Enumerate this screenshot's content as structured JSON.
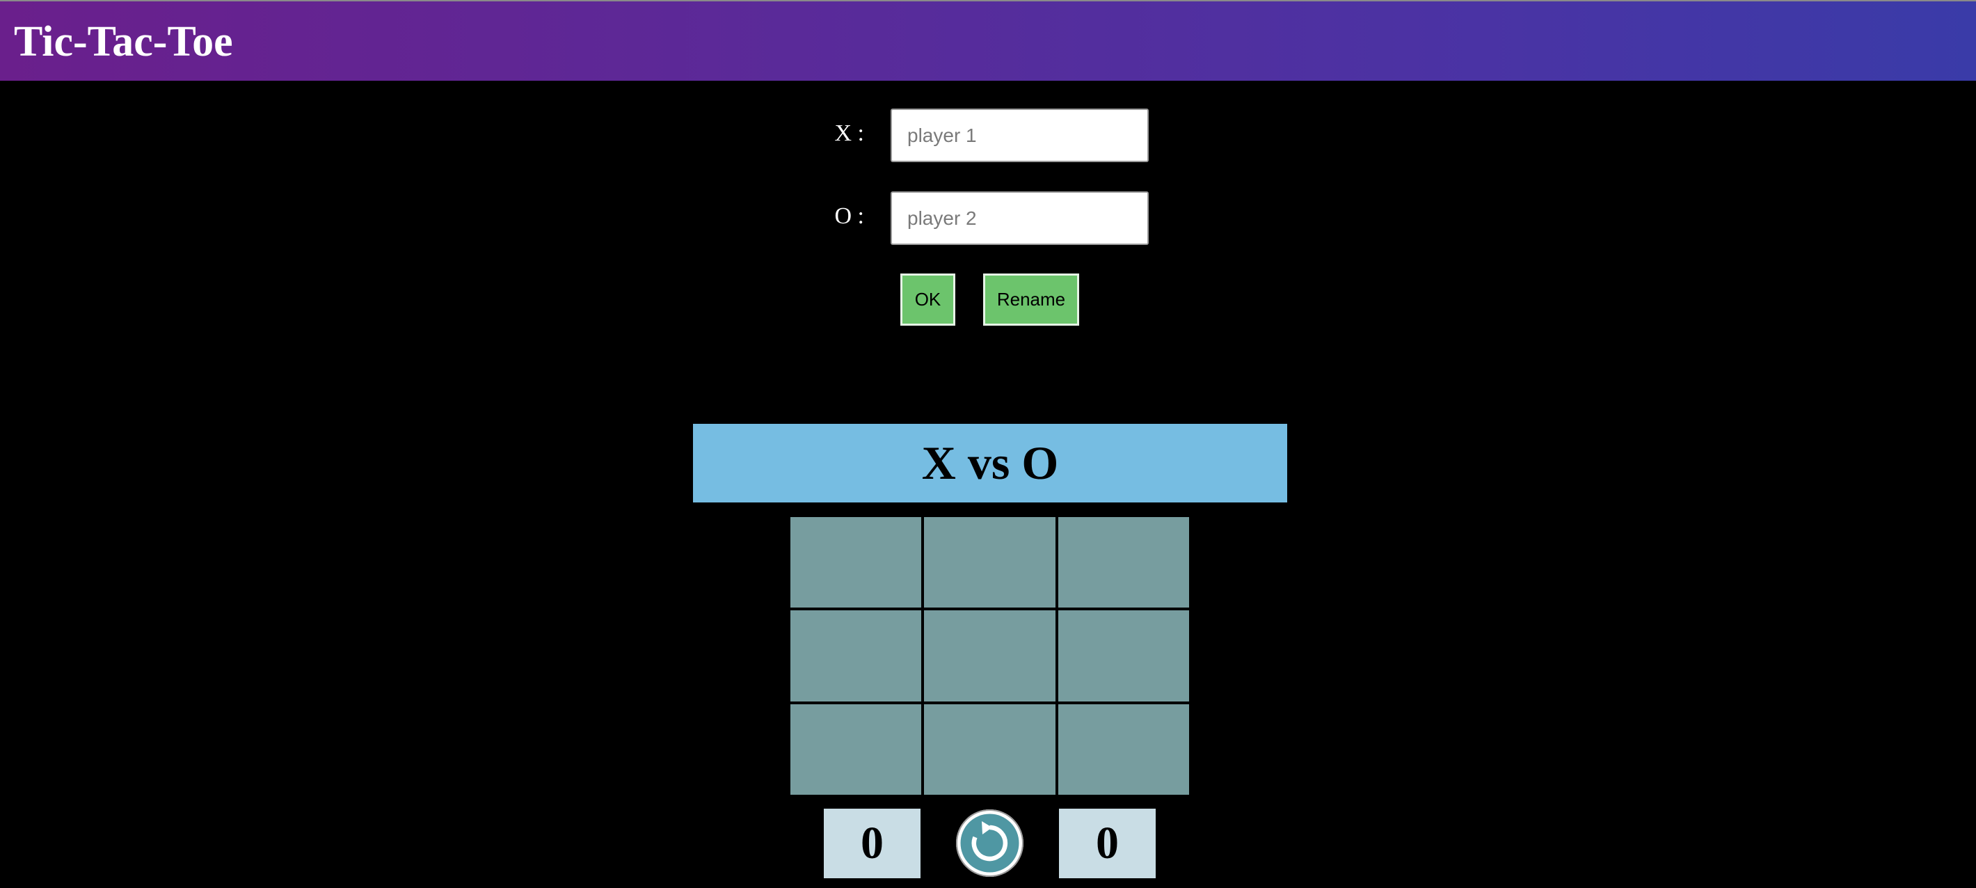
{
  "header": {
    "title": "Tic-Tac-Toe",
    "background_start": "#6a1f8c",
    "background_end": "#3a3ba8"
  },
  "players_form": {
    "x_label": "X :",
    "x_placeholder": "player 1",
    "x_value": "",
    "o_label": "O :",
    "o_placeholder": "player 2",
    "o_value": "",
    "ok_label": "OK",
    "rename_label": "Rename",
    "button_color": "#6cc46c"
  },
  "banner": {
    "text": "X vs O",
    "color": "#76bde2"
  },
  "board": {
    "cell_color": "#779d9f",
    "cells": [
      "",
      "",
      "",
      "",
      "",
      "",
      "",
      "",
      ""
    ]
  },
  "scores": {
    "x_score": "0",
    "o_score": "0"
  },
  "reset": {
    "icon": "refresh-icon",
    "color": "#4f97a3"
  }
}
